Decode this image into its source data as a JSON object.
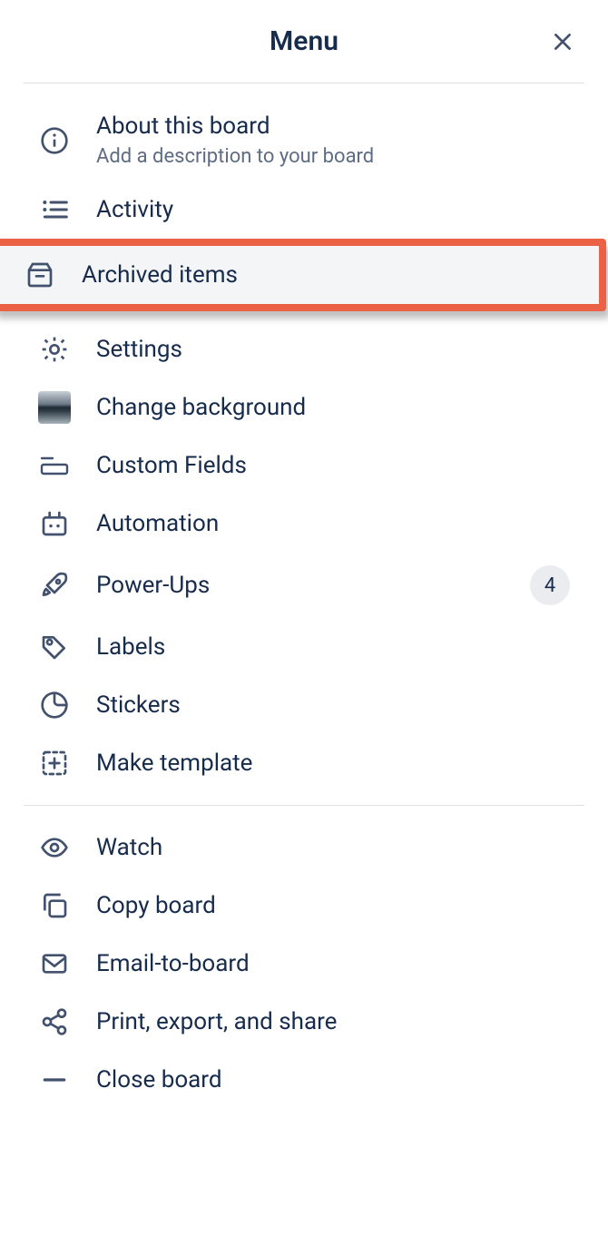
{
  "header": {
    "title": "Menu"
  },
  "items": {
    "about": {
      "label": "About this board",
      "sublabel": "Add a description to your board"
    },
    "activity": {
      "label": "Activity"
    },
    "archived": {
      "label": "Archived items"
    },
    "settings": {
      "label": "Settings"
    },
    "background": {
      "label": "Change background"
    },
    "customfields": {
      "label": "Custom Fields"
    },
    "automation": {
      "label": "Automation"
    },
    "powerups": {
      "label": "Power-Ups",
      "badge": "4"
    },
    "labels": {
      "label": "Labels"
    },
    "stickers": {
      "label": "Stickers"
    },
    "maketemplate": {
      "label": "Make template"
    },
    "watch": {
      "label": "Watch"
    },
    "copyboard": {
      "label": "Copy board"
    },
    "email": {
      "label": "Email-to-board"
    },
    "print": {
      "label": "Print, export, and share"
    },
    "closeboard": {
      "label": "Close board"
    }
  }
}
